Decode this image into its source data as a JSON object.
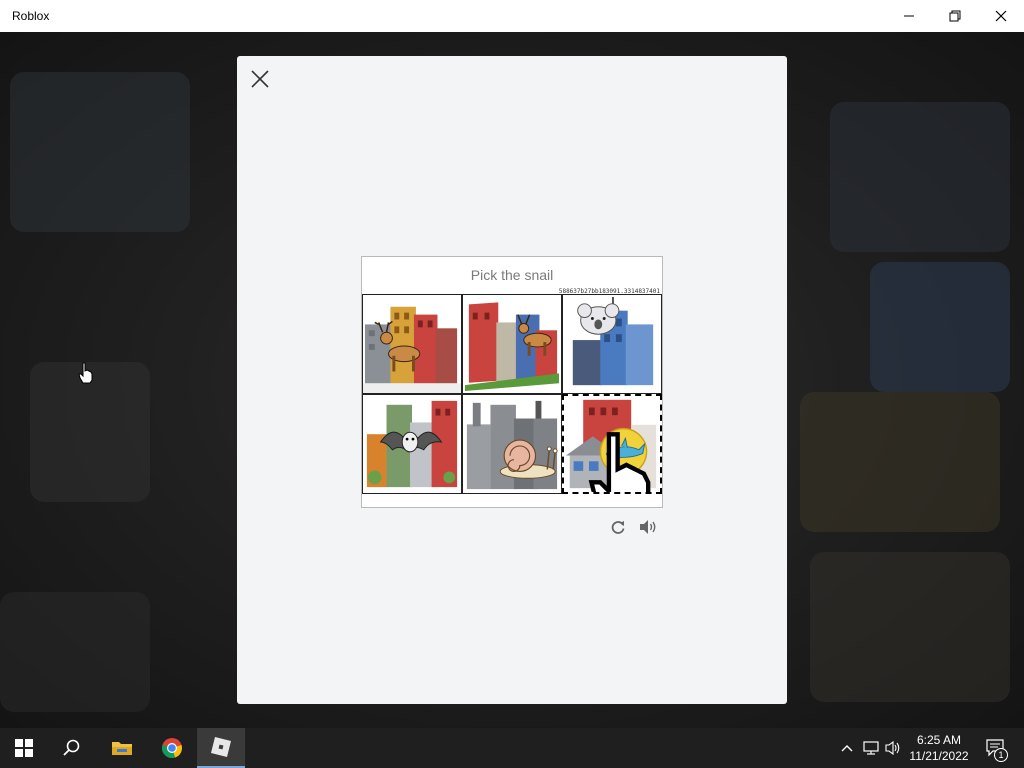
{
  "window": {
    "title": "Roblox",
    "minimize_icon": "minimize-icon",
    "restore_icon": "restore-icon",
    "close_icon": "close-icon"
  },
  "modal": {
    "close_icon": "close-icon"
  },
  "captcha": {
    "prompt": "Pick the snail",
    "session_id": "588637b27bb183091.3314837401",
    "tiles": [
      {
        "animal": "deer",
        "selected": false
      },
      {
        "animal": "deer",
        "selected": false
      },
      {
        "animal": "koala",
        "selected": false
      },
      {
        "animal": "bat",
        "selected": false
      },
      {
        "animal": "snail",
        "selected": false
      },
      {
        "animal": "shark",
        "selected": true
      }
    ],
    "tools": {
      "reload_icon": "refresh-icon",
      "audio_icon": "speaker-icon"
    }
  },
  "taskbar": {
    "apps": [
      "windows-start-icon",
      "search-icon",
      "file-explorer-icon",
      "chrome-icon",
      "roblox-icon"
    ],
    "tray": {
      "chevron_icon": "chevron-up-icon",
      "network_icon": "network-icon",
      "volume_icon": "volume-icon",
      "time": "6:25 AM",
      "date": "11/21/2022",
      "notification_count": "1"
    }
  },
  "colors": {
    "modal_bg": "#f2f4f5",
    "taskbar_bg": "#1f1f1f",
    "titlebar_bg": "#ffffff"
  }
}
